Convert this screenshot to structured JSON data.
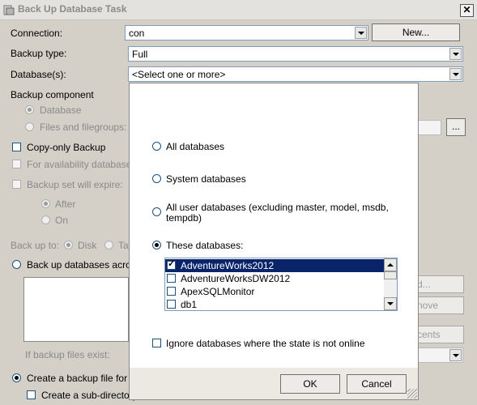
{
  "window": {
    "title": "Back Up Database Task",
    "close_glyph": "✕"
  },
  "form": {
    "connection_label": "Connection:",
    "connection_value": "con",
    "new_button": "New...",
    "backup_type_label": "Backup type:",
    "backup_type_value": "Full",
    "databases_label": "Database(s):",
    "databases_value": "<Select one or more>",
    "backup_component_label": "Backup component",
    "component_database": "Database",
    "component_files": "Files and filegroups:",
    "copy_only": "Copy-only Backup",
    "for_availability": "For availability databases",
    "backup_set_expire": "Backup set will expire:",
    "after_label": "After",
    "on_label": "On",
    "back_up_to": "Back up to:",
    "disk_label": "Disk",
    "tape_label": "Ta",
    "back_up_across": "Back up databases across",
    "if_backup_exists": "If backup files exist:",
    "create_backup_file": "Create a backup file for ev",
    "create_subdir": "Create a sub-directory",
    "browse_button": "...",
    "add_button_partial": "d...",
    "remove_button_partial": "nove",
    "contents_button_partial": "cents"
  },
  "popup": {
    "option_all": "All databases",
    "option_system": "System databases",
    "option_user_line1": "All user databases  (excluding master, model, msdb,",
    "option_user_line2": "tempdb)",
    "option_these": "These databases:",
    "databases": [
      {
        "name": "AdventureWorks2012",
        "checked": true,
        "selected": true
      },
      {
        "name": "AdventureWorksDW2012",
        "checked": false,
        "selected": false
      },
      {
        "name": "ApexSQLMonitor",
        "checked": false,
        "selected": false
      },
      {
        "name": "db1",
        "checked": false,
        "selected": false
      }
    ],
    "ignore_offline": "Ignore databases where the state is not online",
    "ok_button": "OK",
    "cancel_button": "Cancel"
  }
}
